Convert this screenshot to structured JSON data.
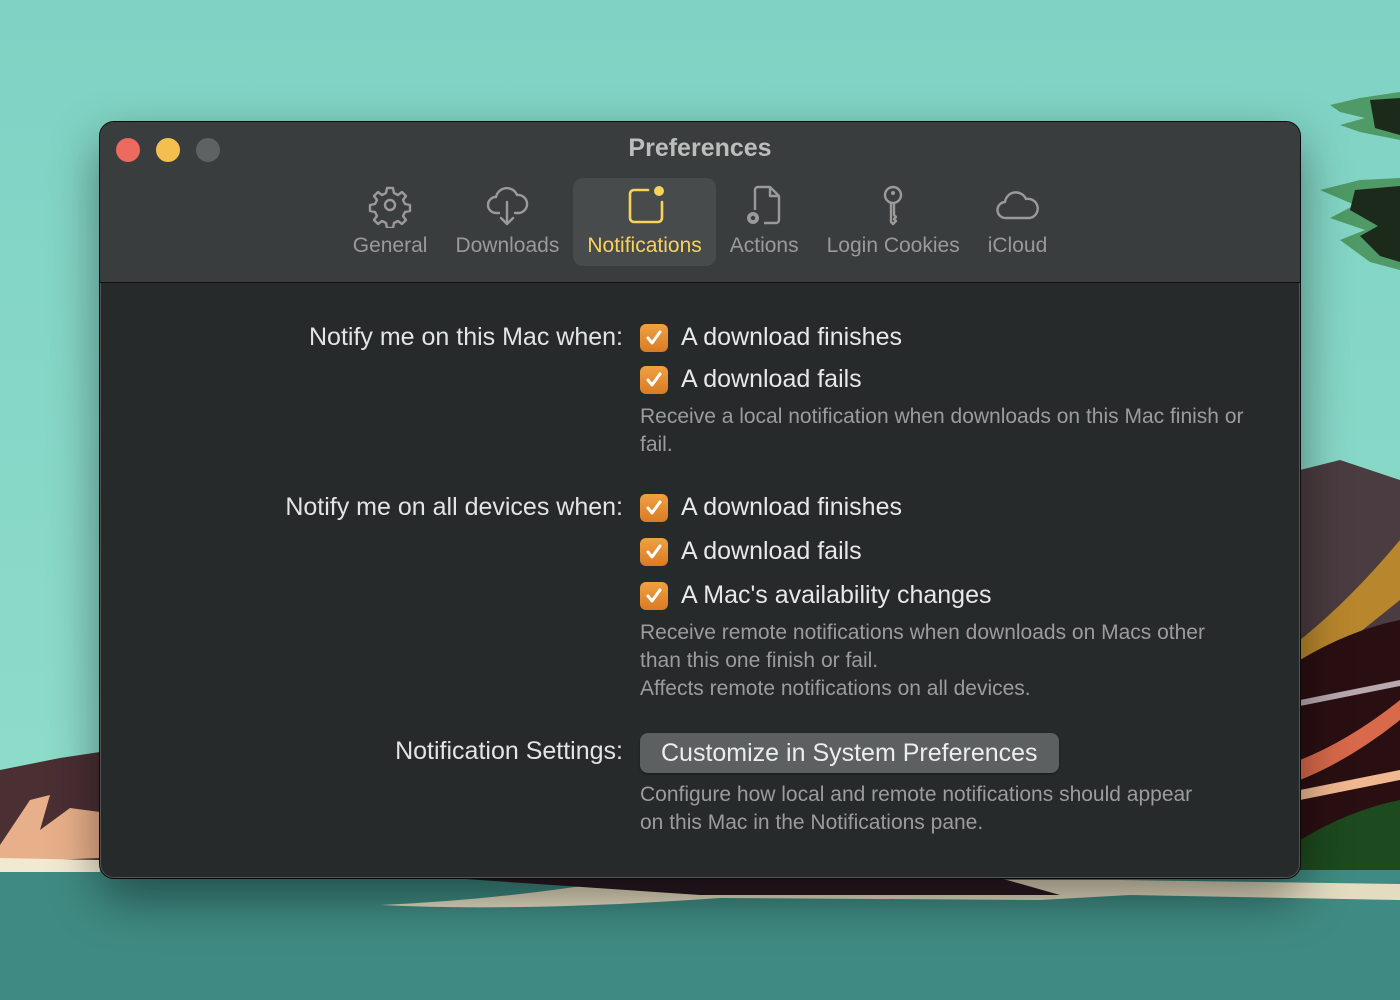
{
  "window": {
    "title": "Preferences",
    "traffic_lights": [
      "close-button",
      "minimize-button",
      "maximize-button"
    ]
  },
  "toolbar": {
    "tabs": [
      {
        "label": "General",
        "icon": "gear-icon",
        "active": false
      },
      {
        "label": "Downloads",
        "icon": "cloud-download-icon",
        "active": false
      },
      {
        "label": "Notifications",
        "icon": "notification-badge-icon",
        "active": true
      },
      {
        "label": "Actions",
        "icon": "document-gear-icon",
        "active": false
      },
      {
        "label": "Login Cookies",
        "icon": "key-icon",
        "active": false
      },
      {
        "label": "iCloud",
        "icon": "cloud-icon",
        "active": false
      }
    ]
  },
  "colors": {
    "accent_active_tab": "#f7d35c",
    "checkbox": "#e58c30",
    "window_bg": "#262a2a",
    "titlebar_bg": "#3a3d3d"
  },
  "sections": {
    "local": {
      "label": "Notify me on this Mac when:",
      "options": [
        {
          "label": "A download finishes",
          "checked": true
        },
        {
          "label": "A download fails",
          "checked": true
        }
      ],
      "description": "Receive a local notification when downloads on this Mac finish or fail."
    },
    "remote": {
      "label": "Notify me on all devices when:",
      "options": [
        {
          "label": "A download finishes",
          "checked": true
        },
        {
          "label": "A download fails",
          "checked": true
        },
        {
          "label": "A Mac's availability changes",
          "checked": true
        }
      ],
      "description_line1": "Receive remote notifications when downloads on Macs other than this one finish or fail.",
      "description_line2": "Affects remote notifications on all devices."
    },
    "settings": {
      "label": "Notification Settings:",
      "button_label": "Customize in System Preferences",
      "description": "Configure how local and remote notifications should appear on this Mac in the Notifications pane."
    }
  }
}
